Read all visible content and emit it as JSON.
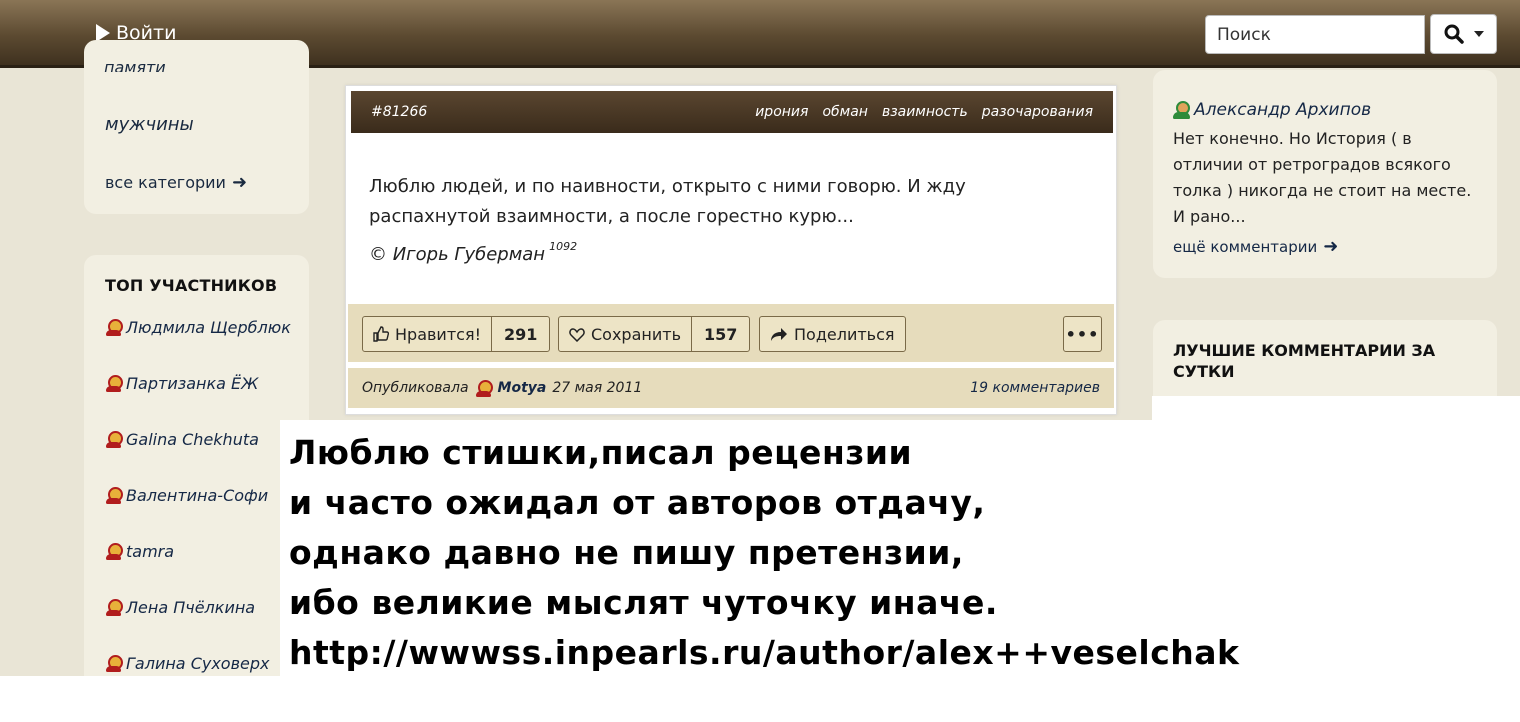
{
  "header": {
    "login_label": "Войти",
    "search_placeholder": "Поиск"
  },
  "left": {
    "cut_category": "памяти",
    "category_men": "мужчины",
    "all_categories": "все категории",
    "top_title": "ТОП УЧАСТНИКОВ",
    "top_users": [
      "Людмила Щерблюк",
      "Партизанка ЁЖ",
      "Galina Chekhuta",
      "Валентина-Софи",
      "tamra",
      "Лена Пчёлкина",
      "Галина Суховерх"
    ]
  },
  "quote": {
    "id": "#81266",
    "tags": [
      "ирония",
      "обман",
      "взаимность",
      "разочарования"
    ],
    "text": "Люблю людей, и по наивности, открыто с ними говорю. И жду распахнутой взаимности, а после горестно курю...",
    "author": "© Игорь Губерман",
    "author_count": "1092",
    "like_label": "Нравится!",
    "like_count": "291",
    "save_label": "Сохранить",
    "save_count": "157",
    "share_label": "Поделиться",
    "more_label": "•••",
    "published_by": "Опубликовала",
    "publisher": "Motya",
    "date": "27 мая 2011",
    "comments": "19 комментариев"
  },
  "right": {
    "comment_user": "Александр Архипов",
    "comment_text": "Нет конечно. Но История ( в отличии от ретроградов всякого толка ) никогда не стоит на месте. И рано...",
    "more_comments": "ещё комментарии",
    "best_title": "ЛУЧШИЕ КОММЕНТАРИИ ЗА СУТКИ"
  },
  "overlay": {
    "lines": [
      "Люблю стишки,писал рецензии",
      "и часто ожидал от авторов отдачу,",
      "однако давно не пишу претензии,",
      "ибо великие мыслят чуточку иначе.",
      "http://wwwss.inpearls.ru/author/alex++veselchak"
    ]
  }
}
